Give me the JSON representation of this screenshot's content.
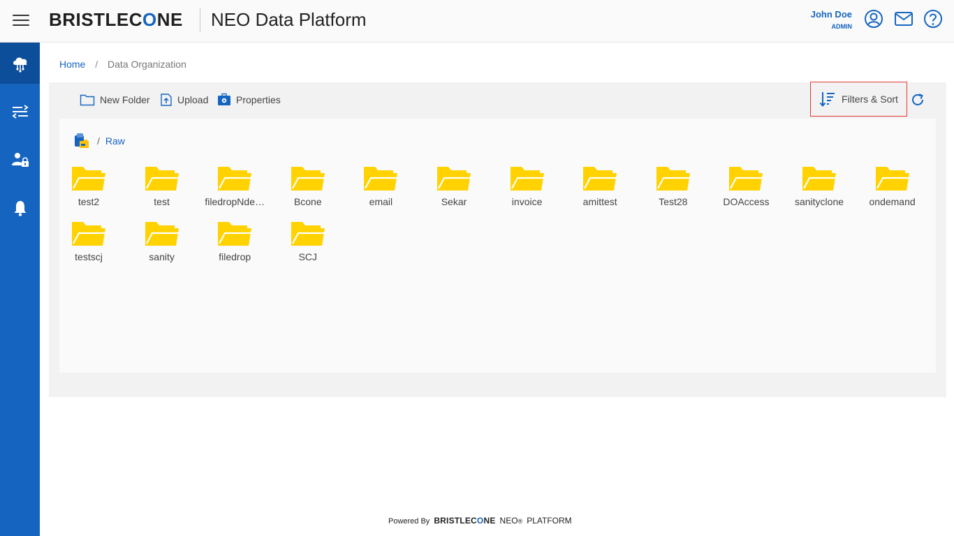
{
  "header": {
    "logo_prefix": "BRISTLEC",
    "logo_o": "O",
    "logo_suffix": "NE",
    "app_title": "NEO Data Platform",
    "user_name": "John Doe",
    "user_role": "ADMIN",
    "icons": [
      "profile-icon",
      "mail-icon",
      "help-icon"
    ]
  },
  "sidebar": {
    "items": [
      {
        "icon": "cloud-network-icon",
        "active": true
      },
      {
        "icon": "pipeline-icon",
        "active": false
      },
      {
        "icon": "user-lock-icon",
        "active": false
      },
      {
        "icon": "bell-icon",
        "active": false
      }
    ],
    "active_color": "#0d4e9a",
    "color": "#1565c0"
  },
  "breadcrumb": {
    "home": "Home",
    "separator": "/",
    "current": "Data Organization"
  },
  "toolbar": {
    "new_folder": "New Folder",
    "upload": "Upload",
    "properties": "Properties",
    "filters_sort": "Filters & Sort"
  },
  "path": {
    "separator": "/",
    "current": "Raw"
  },
  "folders": [
    "test2",
    "test",
    "filedropNde…",
    "Bcone",
    "email",
    "Sekar",
    "invoice",
    "amittest",
    "Test28",
    "DOAccess",
    "sanityclone",
    "ondemand",
    "testscj",
    "sanity",
    "filedrop",
    "SCJ"
  ],
  "footer": {
    "powered_by": "Powered By",
    "brand_prefix": "BRISTLEC",
    "brand_o": "O",
    "brand_suffix": "NE",
    "neo": "NEO",
    "reg": "®",
    "platform": "PLATFORM"
  },
  "colors": {
    "accent": "#1565c0",
    "folder": "#ffd200",
    "highlight_border": "#e53935"
  }
}
